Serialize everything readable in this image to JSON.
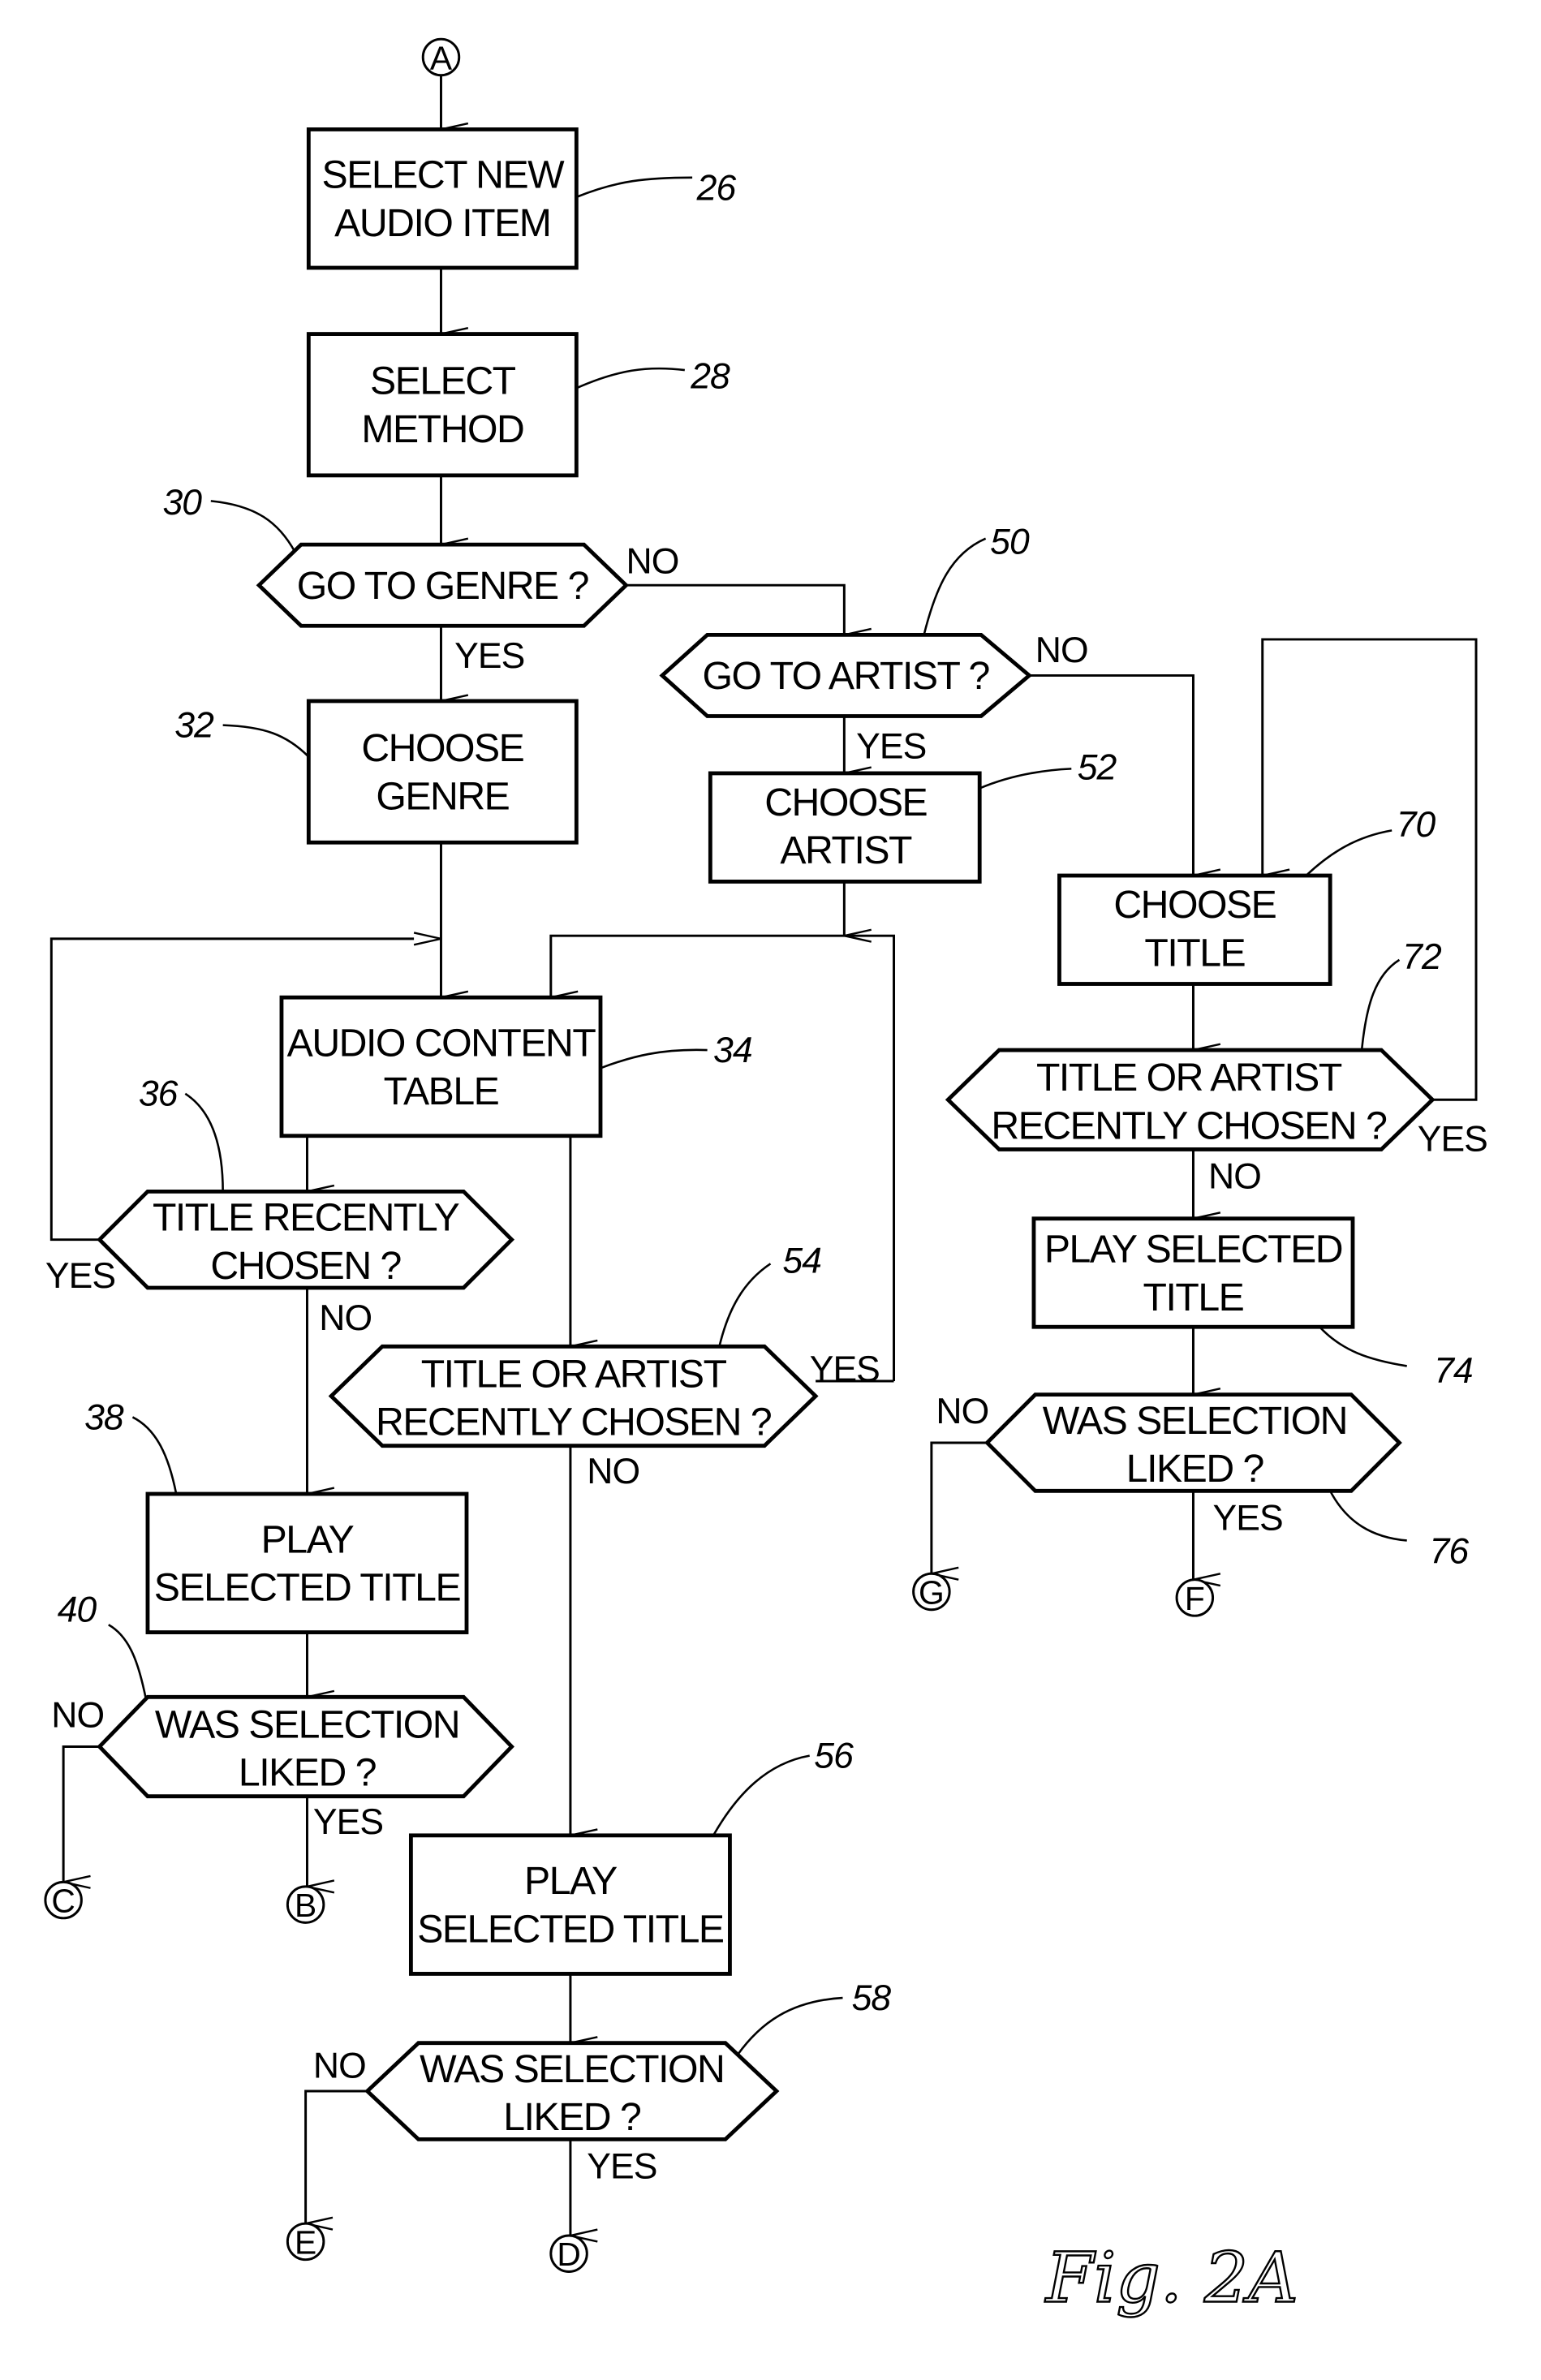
{
  "figure": {
    "label": "Fig. 2A"
  },
  "connectors": {
    "A": "A",
    "B": "B",
    "C": "C",
    "D": "D",
    "E": "E",
    "F": "F",
    "G": "G"
  },
  "steps": {
    "s26": {
      "ref": "26",
      "lines": [
        "SELECT NEW",
        "AUDIO ITEM"
      ]
    },
    "s28": {
      "ref": "28",
      "lines": [
        "SELECT",
        "METHOD"
      ]
    },
    "s30": {
      "ref": "30",
      "lines": [
        "GO TO GENRE ?"
      ]
    },
    "s32": {
      "ref": "32",
      "lines": [
        "CHOOSE",
        "GENRE"
      ]
    },
    "s34": {
      "ref": "34",
      "lines": [
        "AUDIO CONTENT",
        "TABLE"
      ]
    },
    "s36": {
      "ref": "36",
      "lines": [
        "TITLE RECENTLY",
        "CHOSEN ?"
      ]
    },
    "s38": {
      "ref": "38",
      "lines": [
        "PLAY",
        "SELECTED TITLE"
      ]
    },
    "s40": {
      "ref": "40",
      "lines": [
        "WAS SELECTION",
        "LIKED ?"
      ]
    },
    "s50": {
      "ref": "50",
      "lines": [
        "GO TO ARTIST ?"
      ]
    },
    "s52": {
      "ref": "52",
      "lines": [
        "CHOOSE",
        "ARTIST"
      ]
    },
    "s54": {
      "ref": "54",
      "lines": [
        "TITLE OR ARTIST",
        "RECENTLY CHOSEN ?"
      ]
    },
    "s56": {
      "ref": "56",
      "lines": [
        "PLAY",
        "SELECTED TITLE"
      ]
    },
    "s58": {
      "ref": "58",
      "lines": [
        "WAS SELECTION",
        "LIKED ?"
      ]
    },
    "s70": {
      "ref": "70",
      "lines": [
        "CHOOSE",
        "TITLE"
      ]
    },
    "s72": {
      "ref": "72",
      "lines": [
        "TITLE OR ARTIST",
        "RECENTLY CHOSEN ?"
      ]
    },
    "s74": {
      "ref": "74",
      "lines": [
        "PLAY SELECTED",
        "TITLE"
      ]
    },
    "s76": {
      "ref": "76",
      "lines": [
        "WAS SELECTION",
        "LIKED ?"
      ]
    }
  },
  "branches": {
    "yes": "YES",
    "no": "NO"
  }
}
